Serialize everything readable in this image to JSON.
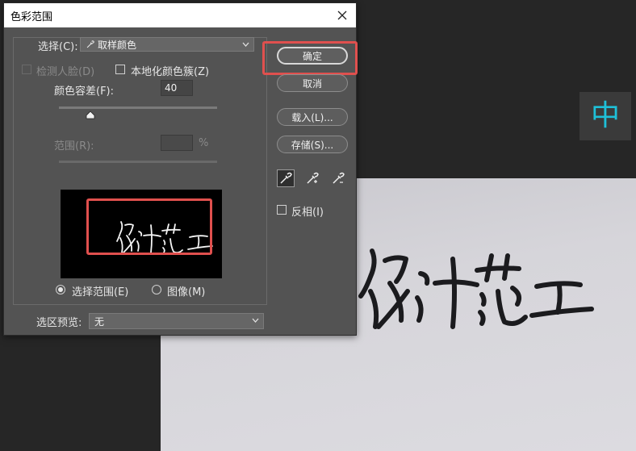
{
  "document": {
    "handwriting_text": "设计范工",
    "ime_indicator": "中"
  },
  "dialog": {
    "title": "色彩范围",
    "select_label": "选择(C):",
    "select_value": "取样颜色",
    "detect_faces_label": "检测人脸(D)",
    "localized_clusters_label": "本地化颜色簇(Z)",
    "fuzziness_label": "颜色容差(F):",
    "fuzziness_value": "40",
    "range_label": "范围(R):",
    "range_unit": "%",
    "preview_text": "设计范工",
    "selection_radio_label": "选择范围(E)",
    "image_radio_label": "图像(M)",
    "selection_preview_label": "选区预览:",
    "selection_preview_value": "无"
  },
  "buttons": {
    "ok": "确定",
    "cancel": "取消",
    "load": "载入(L)...",
    "save": "存储(S)...",
    "invert": "反相(I)"
  },
  "icons": {
    "eyedropper": "eyedropper-icon",
    "eyedropper_add": "eyedropper-plus-icon",
    "eyedropper_subtract": "eyedropper-minus-icon",
    "close": "close-icon",
    "dropdown": "chevron-down-icon"
  },
  "colors": {
    "highlight": "#e0504e",
    "ime": "#1ec0d8",
    "dialog_bg": "#535353"
  }
}
